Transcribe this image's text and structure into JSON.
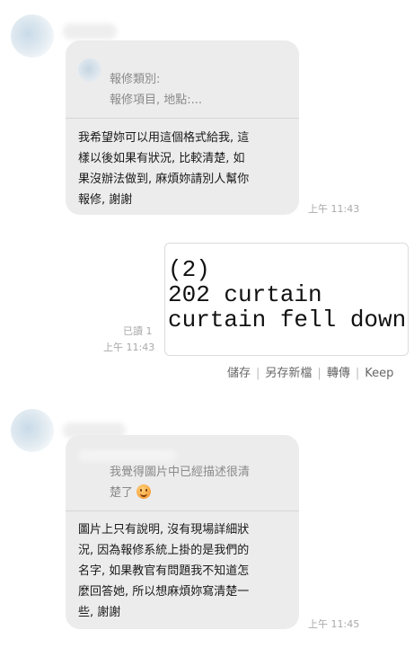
{
  "message1": {
    "quote": {
      "line1": "報修類別:",
      "line2": "報修項目,  地點:..."
    },
    "text_lines": [
      "我希望妳可以用這個格式給我,  這",
      "樣以後如果有狀況,  比較清楚,  如",
      "果沒辦法做到,  麻煩妳請別人幫你",
      "報修,  謝謝"
    ],
    "time": "上午 11:43"
  },
  "my_message": {
    "image_lines": [
      "(2)",
      "202 curtain",
      "curtain fell down"
    ],
    "read_status": "已讀 1",
    "time": "上午 11:43",
    "actions": [
      "儲存",
      "另存新檔",
      "轉傳",
      "Keep"
    ]
  },
  "message2": {
    "quote": {
      "line1": "我覺得圖片中已經描述很清",
      "line2": "楚了",
      "emoji": "smile-emoji"
    },
    "text_lines": [
      "圖片上只有說明,  沒有現場詳細狀",
      "況,  因為報修系統上掛的是我們的",
      "名字,  如果教官有問題我不知道怎",
      "麼回答她,  所以想麻煩妳寫清楚一",
      "些,  謝謝"
    ],
    "time": "上午 11:45"
  }
}
